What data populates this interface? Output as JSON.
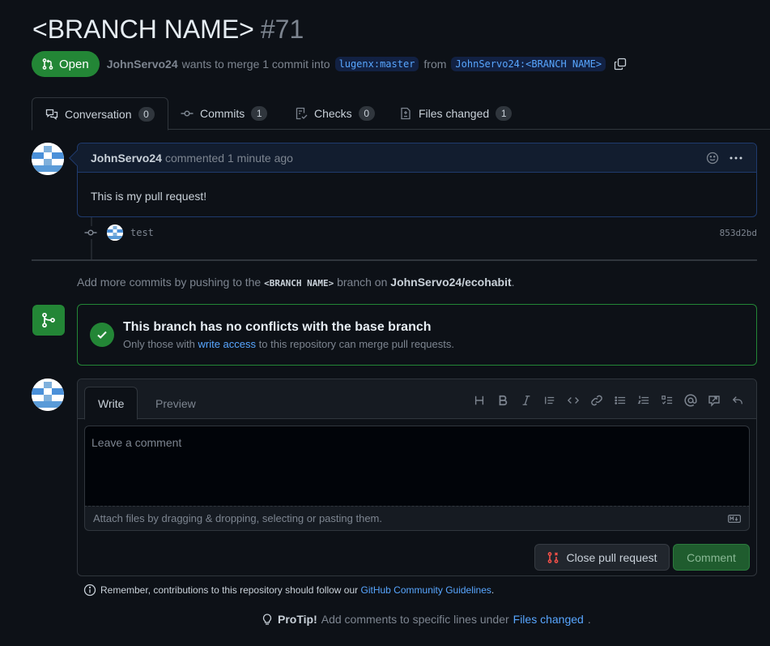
{
  "header": {
    "title": "<BRANCH NAME>",
    "number": "#71",
    "state": "Open",
    "author": "JohnServo24",
    "merge_text_1": "wants to merge 1 commit into",
    "base_ref": "lugenx:master",
    "merge_text_2": "from",
    "head_ref": "JohnServo24:<BRANCH NAME>"
  },
  "tabs": [
    {
      "label": "Conversation",
      "count": "0",
      "icon": "comment-discussion-icon"
    },
    {
      "label": "Commits",
      "count": "1",
      "icon": "git-commit-icon"
    },
    {
      "label": "Checks",
      "count": "0",
      "icon": "checklist-icon"
    },
    {
      "label": "Files changed",
      "count": "1",
      "icon": "file-diff-icon"
    }
  ],
  "comment": {
    "author": "JohnServo24",
    "action": "commented",
    "time": "1 minute ago",
    "body": "This is my pull request!"
  },
  "commit": {
    "message": "test",
    "sha": "853d2bd"
  },
  "push_hint": {
    "prefix": "Add more commits by pushing to the",
    "branch": "<BRANCH NAME>",
    "middle": "branch on",
    "repo": "JohnServo24/ecohabit",
    "suffix": "."
  },
  "merge": {
    "title": "This branch has no conflicts with the base branch",
    "sub_prefix": "Only those with",
    "sub_link": "write access",
    "sub_suffix": "to this repository can merge pull requests."
  },
  "form": {
    "tab_write": "Write",
    "tab_preview": "Preview",
    "placeholder": "Leave a comment",
    "attach_text": "Attach files by dragging & dropping, selecting or pasting them.",
    "close_label": "Close pull request",
    "comment_label": "Comment",
    "toolbar": [
      "heading-icon",
      "bold-icon",
      "italic-icon",
      "quote-icon",
      "code-icon",
      "link-icon",
      "unordered-list-icon",
      "ordered-list-icon",
      "task-list-icon",
      "mention-icon",
      "reference-icon",
      "reply-icon"
    ]
  },
  "footer": {
    "guidelines_text": "Remember, contributions to this repository should follow our",
    "guidelines_link": "GitHub Community Guidelines",
    "guidelines_suffix": ".",
    "protip_label": "ProTip!",
    "protip_text": "Add comments to specific lines under",
    "protip_link": "Files changed",
    "protip_suffix": "."
  },
  "colors": {
    "background": "#0d1117",
    "accent_green": "#238636",
    "link_blue": "#58a6ff",
    "muted": "#7d8590"
  }
}
